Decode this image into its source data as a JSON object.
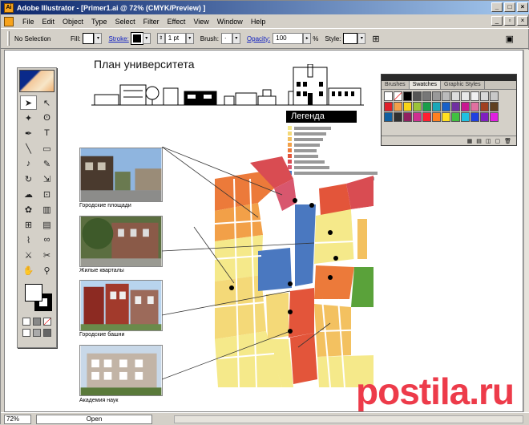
{
  "window": {
    "title": "Adobe Illustrator - [Primer1.ai @ 72% (CMYK/Preview) ]",
    "app_icon": "Ai"
  },
  "menu": [
    "File",
    "Edit",
    "Object",
    "Type",
    "Select",
    "Filter",
    "Effect",
    "View",
    "Window",
    "Help"
  ],
  "control": {
    "selection": "No Selection",
    "fill_label": "Fill:",
    "stroke_label": "Stroke:",
    "stroke_weight": "1 pt",
    "brush_label": "Brush:",
    "opacity_label": "Opacity:",
    "opacity_value": "100",
    "opacity_unit": "%",
    "style_label": "Style:"
  },
  "panel": {
    "tabs": [
      "Brushes",
      "Swatches",
      "Graphic Styles"
    ],
    "active_tab": "Swatches",
    "swatches": [
      "#ffffff",
      "none",
      "#000000",
      "#555555",
      "#777777",
      "#999999",
      "#bbbbbb",
      "#dddddd",
      "#e8e8e8",
      "#f0f0f0",
      "#d8d8d8",
      "#c8c8c8",
      "#e0202a",
      "#f3a04a",
      "#f7d418",
      "#9bc43a",
      "#1a9e4a",
      "#1aa7b8",
      "#1860c8",
      "#7030a0",
      "#c81890",
      "#e070a0",
      "#a04020",
      "#604020",
      "#1060a0",
      "#303030",
      "#902060",
      "#d03090",
      "#ff2030",
      "#ff8020",
      "#ffe020",
      "#40c040",
      "#20c0e0",
      "#2040e0",
      "#8020c0",
      "#e020e0"
    ]
  },
  "artwork": {
    "title": "План университета",
    "legend_title": "Легенда",
    "captions": [
      "Городские площади",
      "Жилые кварталы",
      "Городские башни",
      "Академия наук"
    ]
  },
  "status": {
    "zoom": "72%",
    "state": "Open"
  },
  "watermark": "postila.ru",
  "colors": {
    "title_start": "#0a246a",
    "title_end": "#a6caf0",
    "watermark": "#ed3b4a"
  }
}
